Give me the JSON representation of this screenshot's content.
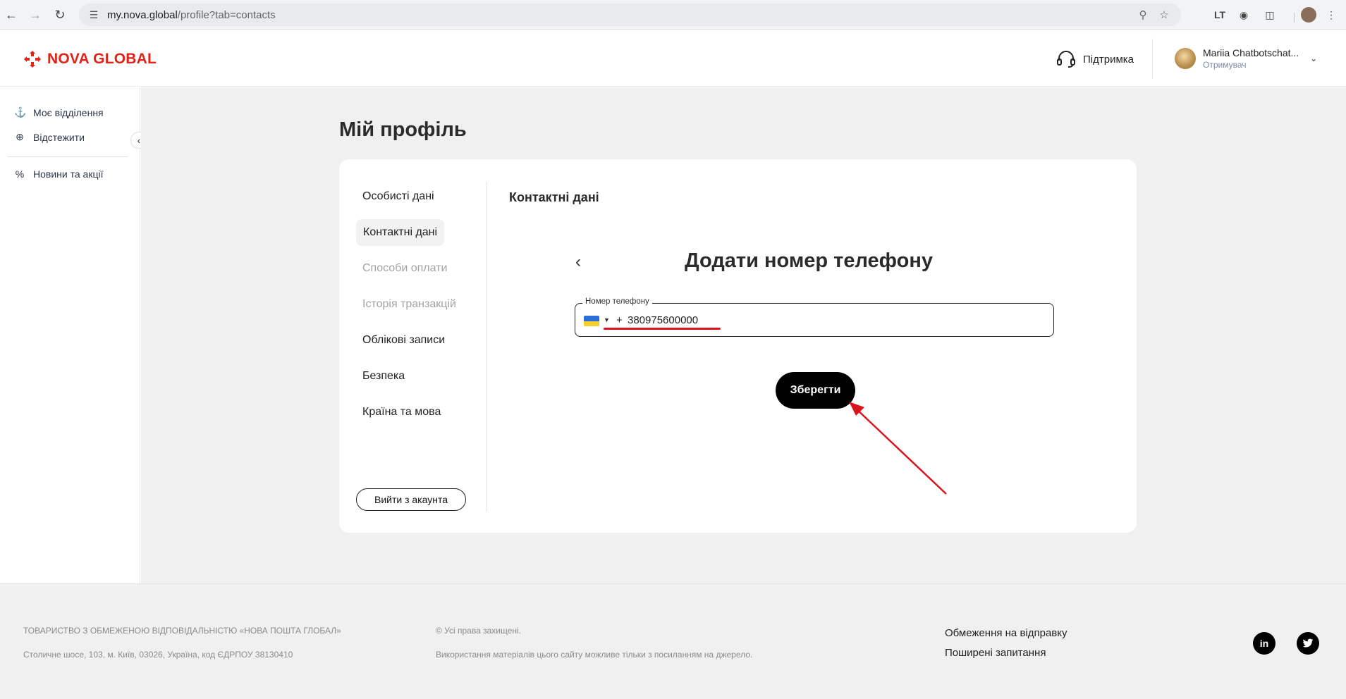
{
  "browser": {
    "url_host": "my.nova.global",
    "url_path": "/profile?tab=contacts"
  },
  "header": {
    "logo_text": "NOVA GLOBAL",
    "support_label": "Підтримка",
    "user_name": "Mariia Chatbotschat...",
    "user_role": "Отримувач"
  },
  "sidebar": {
    "items": [
      {
        "label": "Моє відділення",
        "icon": "parcel-icon"
      },
      {
        "label": "Відстежити",
        "icon": "track-icon"
      },
      {
        "label": "Новини та акції",
        "icon": "percent-icon"
      }
    ]
  },
  "page": {
    "title": "Мій профіль"
  },
  "profile_tabs": [
    {
      "label": "Особисті дані",
      "state": "normal"
    },
    {
      "label": "Контактні дані",
      "state": "active"
    },
    {
      "label": "Способи оплати",
      "state": "disabled"
    },
    {
      "label": "Історія транзакцій",
      "state": "disabled"
    },
    {
      "label": "Облікові записи",
      "state": "normal"
    },
    {
      "label": "Безпека",
      "state": "normal"
    },
    {
      "label": "Країна та мова",
      "state": "normal"
    }
  ],
  "logout_label": "Вийти з акаунта",
  "section": {
    "title": "Контактні дані",
    "form_title": "Додати номер телефону",
    "phone_label": "Номер телефону",
    "phone_prefix": "+",
    "phone_value": "380975600000",
    "save_label": "Зберегти"
  },
  "colors": {
    "brand_red": "#e2231a",
    "annotation_red": "#d9141c"
  },
  "footer": {
    "company": "ТОВАРИСТВО З ОБМЕЖЕНОЮ ВІДПОВІДАЛЬНІСТЮ «НОВА ПОШТА ГЛОБАЛ»",
    "address": "Столичне шосе, 103, м. Київ, 03026, Україна, код ЄДРПОУ 38130410",
    "rights": "© Усі права захищені.",
    "usage_note": "Використання матеріалів цього сайту можливе тільки з посиланням на джерело.",
    "links": [
      "Обмеження на відправку",
      "Поширені запитання"
    ],
    "social": [
      "in",
      "twitter"
    ]
  }
}
